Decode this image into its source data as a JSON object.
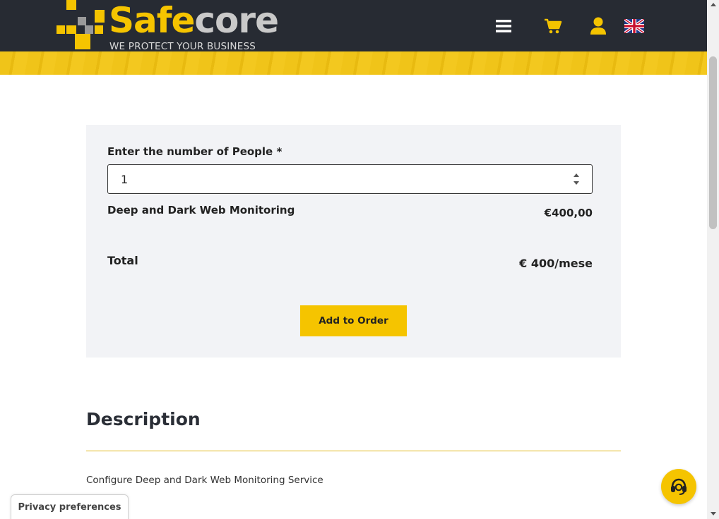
{
  "header": {
    "brand_part1": "Safe",
    "brand_part2": "core",
    "tagline": "WE PROTECT YOUR BUSINESS",
    "icons": [
      "menu-icon",
      "cart-icon",
      "user-icon",
      "uk-flag-icon"
    ]
  },
  "form": {
    "people_label": "Enter the number of People *",
    "people_value": "1"
  },
  "line_item": {
    "name": "Deep and Dark Web Monitoring",
    "price": "€400,00"
  },
  "total": {
    "label": "Total",
    "value": "€ 400/mese"
  },
  "actions": {
    "add_to_order": "Add to Order"
  },
  "description": {
    "title": "Description",
    "text": "Configure Deep and Dark Web Monitoring Service"
  },
  "privacy": {
    "label": "Privacy preferences"
  },
  "support": {
    "icon": "headset-icon"
  },
  "colors": {
    "header_bg": "#272b33",
    "accent_yellow": "#f5c400",
    "panel_bg": "#f2f3f6"
  }
}
